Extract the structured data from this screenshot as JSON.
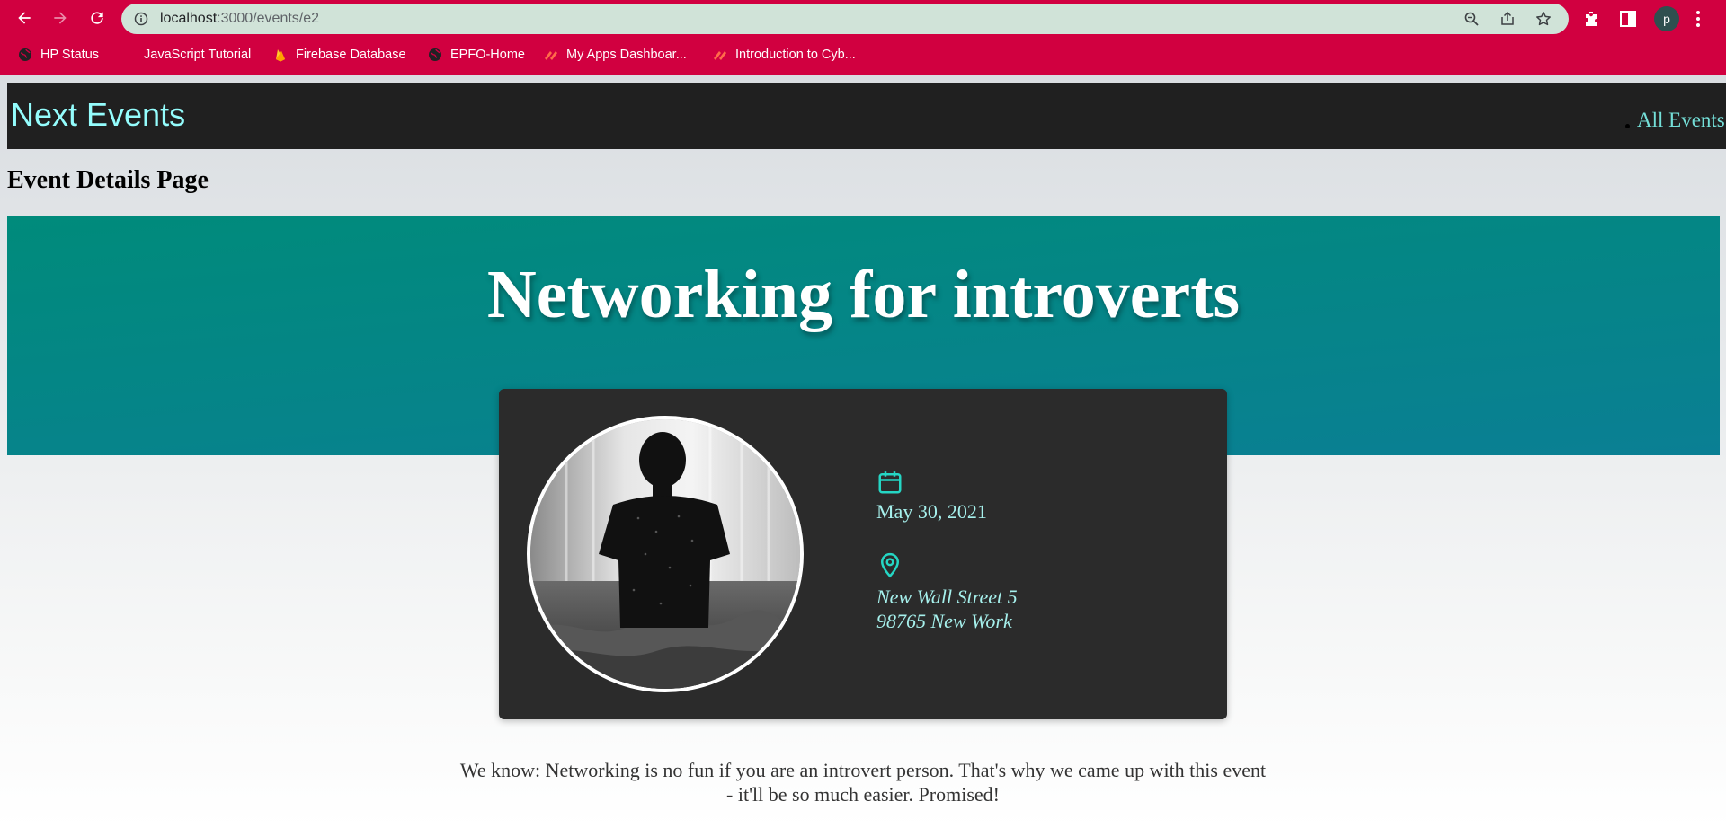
{
  "browser": {
    "url_host": "localhost",
    "url_path": ":3000/events/e2",
    "profile_initial": "p",
    "bookmarks": [
      {
        "label": "HP Status",
        "icon": "globe-icon"
      },
      {
        "label": "JavaScript Tutorial",
        "icon": "w3-icon"
      },
      {
        "label": "Firebase Database",
        "icon": "firebase-icon"
      },
      {
        "label": "EPFO-Home",
        "icon": "globe-icon"
      },
      {
        "label": "My Apps Dashboar...",
        "icon": "apps-icon"
      },
      {
        "label": "Introduction to Cyb...",
        "icon": "apps-icon"
      }
    ]
  },
  "header": {
    "logo": "Next Events",
    "nav_link": "All Events"
  },
  "page": {
    "heading": "Event Details Page"
  },
  "event": {
    "title": "Networking for introverts",
    "date": "May 30, 2021",
    "address_line1": "New Wall Street 5",
    "address_line2": "98765 New Work",
    "description": "We know: Networking is no fun if you are an introvert person. That's why we came up with this event - it'll be so much easier. Promised!"
  },
  "colors": {
    "chrome_bar": "#d10040",
    "omnibox": "#d0e3d8",
    "header_bg": "#202020",
    "logo": "#94fdfd",
    "accent": "#25d6c4",
    "hero_start": "#008b7b",
    "hero_end": "#0a7f94",
    "card_bg": "#2b2b2b"
  }
}
